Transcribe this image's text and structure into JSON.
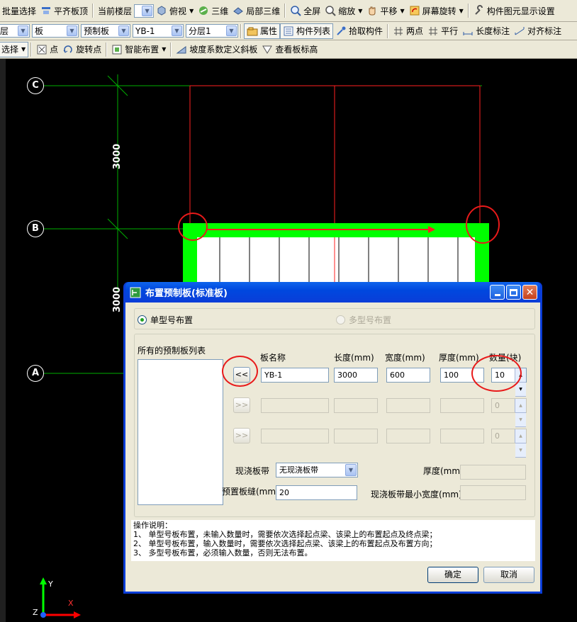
{
  "toolbar1": {
    "items": [
      "批量选择",
      "平齐板顶",
      "当前楼层",
      "俯视",
      "三维",
      "局部三维",
      "全屏",
      "缩放",
      "平移",
      "屏幕旋转",
      "构件图元显示设置"
    ]
  },
  "toolbar2": {
    "combo_floor": "层",
    "combo_type": "板",
    "combo_subtype": "预制板",
    "combo_name": "YB-1",
    "combo_layer": "分层1",
    "items": [
      "属性",
      "构件列表",
      "拾取构件",
      "两点",
      "平行",
      "长度标注",
      "对齐标注"
    ]
  },
  "toolbar3": {
    "items": [
      "选择",
      "点",
      "旋转点",
      "智能布置",
      "坡度系数定义斜板",
      "查看板标高"
    ]
  },
  "canvas": {
    "axes": [
      "C",
      "B",
      "A"
    ],
    "dimensions": [
      "3000",
      "3000"
    ],
    "ucs": {
      "y": "Y",
      "x": "X",
      "z": "Z"
    }
  },
  "dialog": {
    "title": "布置预制板(标准板)",
    "radio_single": "单型号布置",
    "radio_multi": "多型号布置",
    "list_title": "所有的预制板列表",
    "headers": {
      "name": "板名称",
      "length": "长度(mm)",
      "width": "宽度(mm)",
      "thickness": "厚度(mm)",
      "count": "数量(块)"
    },
    "rows": [
      {
        "button": "<<",
        "name": "YB-1",
        "length": "3000",
        "width": "600",
        "thickness": "100",
        "count": "10"
      },
      {
        "button": ">>",
        "name": "",
        "length": "",
        "width": "",
        "thickness": "",
        "count": "0"
      },
      {
        "button": ">>",
        "name": "",
        "length": "",
        "width": "",
        "thickness": "",
        "count": "0"
      }
    ],
    "cast_label": "现浇板带",
    "cast_value": "无现浇板带",
    "gap_label": "预置板缝(mm)",
    "gap_value": "20",
    "thick_label": "厚度(mm)",
    "min_width_label": "现浇板带最小宽度(mm)",
    "notes_title": "操作说明：",
    "notes": [
      "1、 单型号板布置，未输入数量时，需要依次选择起点梁、该梁上的布置起点及终点梁；",
      "2、 单型号板布置，输入数量时，需要依次选择起点梁、该梁上的布置起点及布置方向；",
      "3、 多型号板布置，必须输入数量，否则无法布置。"
    ],
    "ok": "确定",
    "cancel": "取消"
  },
  "colors": {
    "highlight": "#e81a1a",
    "slab": "#00ff00",
    "grid": "#00b000",
    "redline": "#ff2020"
  }
}
